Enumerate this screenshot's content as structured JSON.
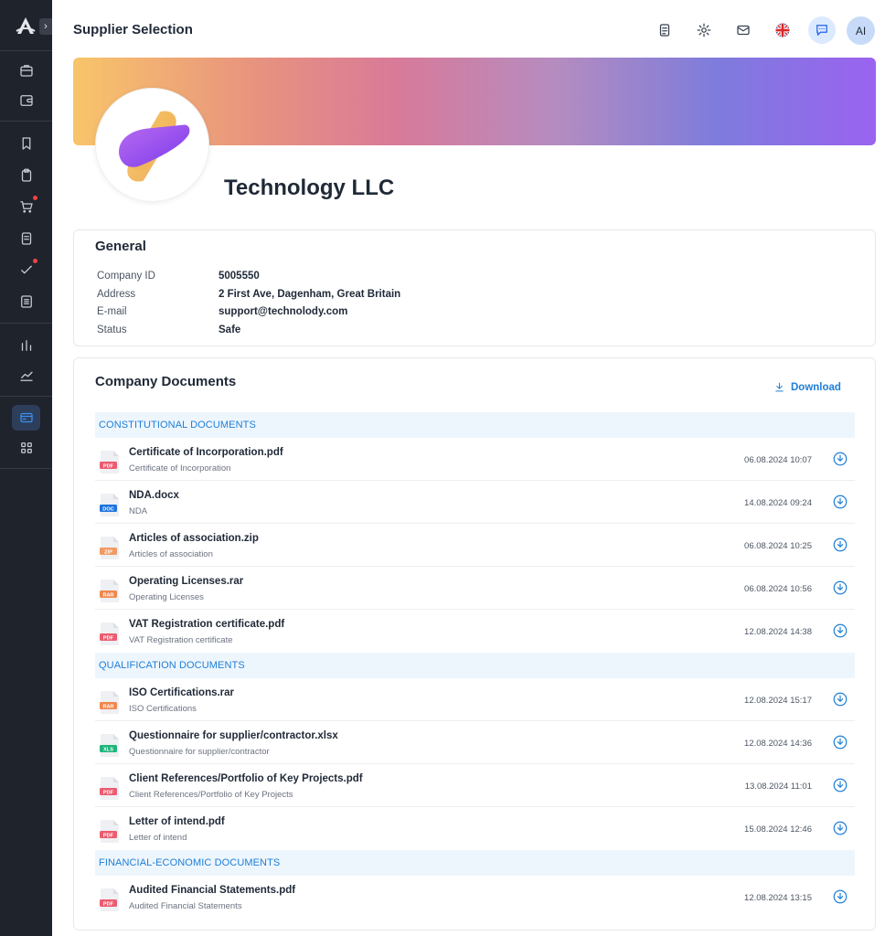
{
  "header": {
    "title": "Supplier Selection",
    "avatar_initials": "AI",
    "language": "English (UK)"
  },
  "colors": {
    "accent": "#1e7fd6",
    "sidebar_bg": "#1f232c",
    "section_bg": "#eef6fd"
  },
  "company": {
    "name": "Technology LLC"
  },
  "general": {
    "title": "General",
    "fields": [
      {
        "label": "Company ID",
        "value": "5005550"
      },
      {
        "label": "Address",
        "value": "2 First Ave, Dagenham, Great Britain"
      },
      {
        "label": "E-mail",
        "value": "support@technolody.com"
      },
      {
        "label": "Status",
        "value": "Safe"
      }
    ]
  },
  "documents": {
    "title": "Company Documents",
    "download_label": "Download",
    "sections": [
      {
        "name": "CONSTITUTIONAL DOCUMENTS",
        "items": [
          {
            "name": "Certificate of Incorporation.pdf",
            "sub": "Certificate of Incorporation",
            "type": "PDF",
            "date": "06.08.2024",
            "time": "10:07"
          },
          {
            "name": "NDA.docx",
            "sub": "NDA",
            "type": "DOC",
            "date": "14.08.2024",
            "time": "09:24"
          },
          {
            "name": "Articles of association.zip",
            "sub": "Articles of association",
            "type": "ZIP",
            "date": "06.08.2024",
            "time": "10:25"
          },
          {
            "name": "Operating Licenses.rar",
            "sub": "Operating Licenses",
            "type": "RAR",
            "date": "06.08.2024",
            "time": "10:56"
          },
          {
            "name": "VAT Registration certificate.pdf",
            "sub": "VAT Registration certificate",
            "type": "PDF",
            "date": "12.08.2024",
            "time": "14:38"
          }
        ]
      },
      {
        "name": "QUALIFICATION DOCUMENTS",
        "items": [
          {
            "name": "ISO Certifications.rar",
            "sub": "ISO Certifications",
            "type": "RAR",
            "date": "12.08.2024",
            "time": "15:17"
          },
          {
            "name": "Questionnaire for supplier/contractor.xlsx",
            "sub": "Questionnaire for supplier/contractor",
            "type": "XLS",
            "date": "12.08.2024",
            "time": "14:36"
          },
          {
            "name": "Client References/Portfolio of Key Projects.pdf",
            "sub": "Client References/Portfolio of Key Projects",
            "type": "PDF",
            "date": "13.08.2024",
            "time": "11:01"
          },
          {
            "name": "Letter of intend.pdf",
            "sub": "Letter of intend",
            "type": "PDF",
            "date": "15.08.2024",
            "time": "12:46"
          }
        ]
      },
      {
        "name": "FINANCIAL-ECONOMIC DOCUMENTS",
        "items": [
          {
            "name": "Audited Financial Statements.pdf",
            "sub": "Audited Financial Statements",
            "type": "PDF",
            "date": "12.08.2024",
            "time": "13:15"
          }
        ]
      }
    ]
  },
  "file_type_colors": {
    "PDF": "#ec5b6f",
    "DOC": "#1d74e0",
    "ZIP": "#f29a63",
    "RAR": "#f0874d",
    "XLS": "#1fb47b"
  }
}
